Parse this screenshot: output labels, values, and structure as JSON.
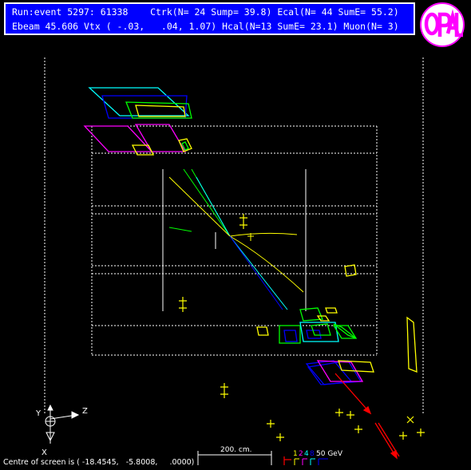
{
  "header": {
    "line1": "Run:event 5297: 61338    Ctrk(N= 24 Sump= 39.8) Ecal(N= 44 SumE= 55.2)",
    "line2": "Ebeam 45.606 Vtx ( -.03,   .04, 1.07) Hcal(N=13 SumE= 23.1) Muon(N= 3)"
  },
  "logo": {
    "text": "OPAL"
  },
  "axes": {
    "y_label": "Y",
    "z_label": "Z",
    "x_label": "X"
  },
  "scale": {
    "length_label": "200. cm.",
    "energy_numbers": [
      "1",
      "2",
      "4",
      "8"
    ],
    "energy_unit": "50 GeV"
  },
  "footer": {
    "centre": "Centre of screen is ( -18.4545,   -5.8008,     .0000)"
  },
  "colors": {
    "header_bg": "#0000ff",
    "white": "#ffffff",
    "yellow": "#ffff00",
    "magenta": "#ff00ff",
    "cyan": "#00ffff",
    "green": "#00ff00",
    "blue": "#0000ff",
    "red": "#ff0000",
    "logo": "#ff00ff"
  }
}
